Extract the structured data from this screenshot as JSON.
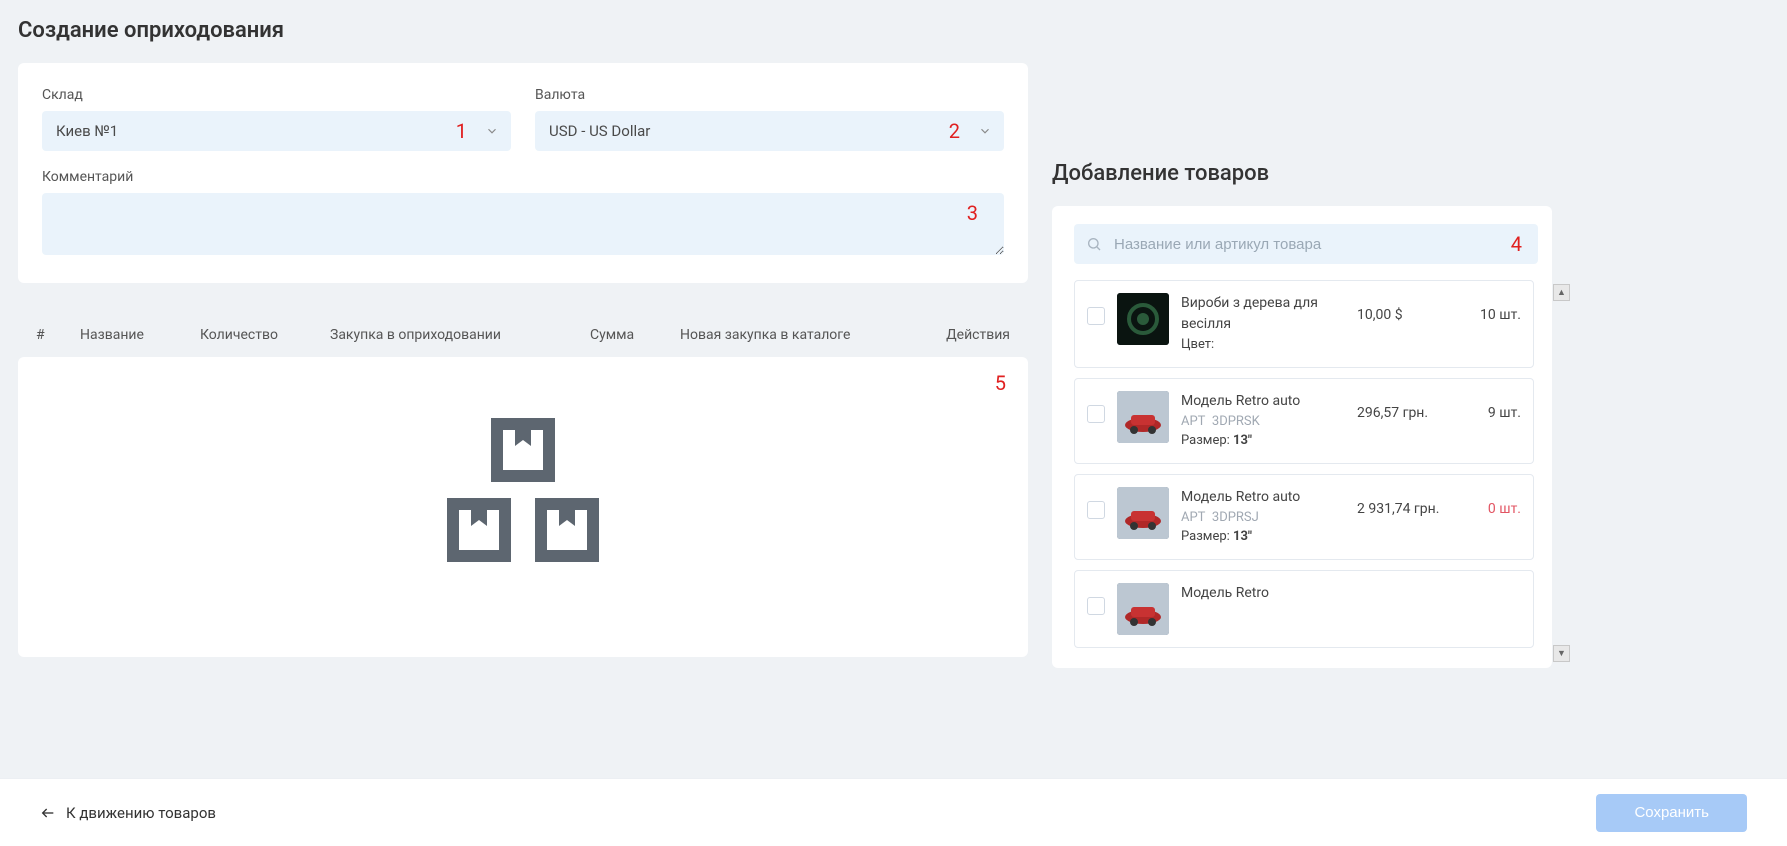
{
  "page_title": "Создание оприходования",
  "form": {
    "warehouse_label": "Склад",
    "warehouse_value": "Киев №1",
    "currency_label": "Валюта",
    "currency_value": "USD - US Dollar",
    "comment_label": "Комментарий",
    "comment_value": ""
  },
  "annotations": {
    "a1": "1",
    "a2": "2",
    "a3": "3",
    "a4": "4",
    "a5": "5"
  },
  "table_headers": {
    "num": "#",
    "name": "Название",
    "qty": "Количество",
    "purchase": "Закупка в оприходовании",
    "sum": "Сумма",
    "catalog": "Новая закупка в каталоге",
    "actions": "Действия"
  },
  "right": {
    "title": "Добавление товаров",
    "search_placeholder": "Название или артикул товара",
    "products": [
      {
        "name": "Вироби з дерева для весілля",
        "sku_label": "",
        "sku": "",
        "attr_label": "Цвет:",
        "attr_value": "",
        "price": "10,00 $",
        "stock": "10 шт.",
        "zero": false,
        "thumb": "green"
      },
      {
        "name": "Модель Retro auto",
        "sku_label": "АРТ",
        "sku": "3DPRSK",
        "attr_label": "Размер:",
        "attr_value": "13\"",
        "price": "296,57 грн.",
        "stock": "9 шт.",
        "zero": false,
        "thumb": "car"
      },
      {
        "name": "Модель Retro auto",
        "sku_label": "АРТ",
        "sku": "3DPRSJ",
        "attr_label": "Размер:",
        "attr_value": "13\"",
        "price": "2 931,74 грн.",
        "stock": "0 шт.",
        "zero": true,
        "thumb": "car"
      },
      {
        "name": "Модель Retro",
        "sku_label": "",
        "sku": "",
        "attr_label": "",
        "attr_value": "",
        "price": "",
        "stock": "",
        "zero": false,
        "thumb": "car"
      }
    ]
  },
  "footer": {
    "back_label": "К движению товаров",
    "save_label": "Сохранить"
  }
}
